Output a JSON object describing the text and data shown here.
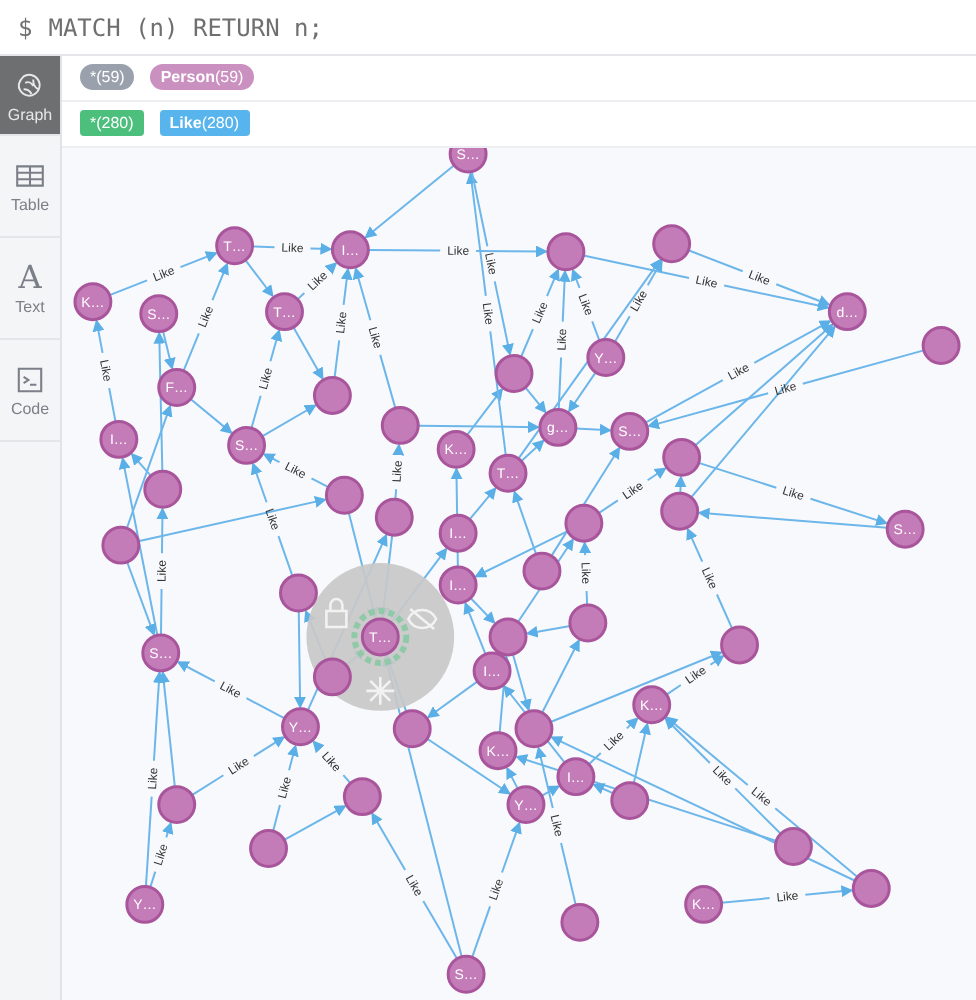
{
  "query": {
    "prompt": "$",
    "text": "MATCH (n) RETURN n;"
  },
  "sidebar": {
    "items": [
      {
        "kind": "graph",
        "label": "Graph",
        "selected": true
      },
      {
        "kind": "table",
        "label": "Table",
        "selected": false
      },
      {
        "kind": "text",
        "glyph": "A",
        "label": "Text",
        "selected": false
      },
      {
        "kind": "code",
        "label": "Code",
        "selected": false
      }
    ]
  },
  "node_labels": [
    {
      "kind": "all",
      "text": "*(59)",
      "color": "#9aa1ac"
    },
    {
      "kind": "label",
      "name": "Person",
      "count": "(59)",
      "color": "#c990c0"
    }
  ],
  "relationship_types": [
    {
      "kind": "all",
      "text": "*(280)",
      "color": "#4cbf7d"
    },
    {
      "kind": "type",
      "name": "Like",
      "count": "(280)",
      "color": "#57b4ec"
    }
  ],
  "graph": {
    "nodes": [
      {
        "kind": "captioned",
        "caption": "S…"
      },
      {
        "kind": "captioned",
        "caption": "T…"
      },
      {
        "kind": "captioned",
        "caption": "I…"
      },
      {
        "kind": "plain"
      },
      {
        "kind": "plain"
      },
      {
        "kind": "captioned",
        "caption": "K…"
      },
      {
        "kind": "captioned",
        "caption": "S…"
      },
      {
        "kind": "captioned",
        "caption": "T…"
      },
      {
        "kind": "captioned",
        "caption": "d…"
      },
      {
        "kind": "plain"
      },
      {
        "kind": "captioned",
        "caption": "Y…"
      },
      {
        "kind": "captioned",
        "caption": "F…"
      },
      {
        "kind": "plain"
      },
      {
        "kind": "plain"
      },
      {
        "kind": "captioned",
        "caption": "I…"
      },
      {
        "kind": "captioned",
        "caption": "S…"
      },
      {
        "kind": "plain"
      },
      {
        "kind": "captioned",
        "caption": "g…"
      },
      {
        "kind": "captioned",
        "caption": "S…"
      },
      {
        "kind": "captioned",
        "caption": "K…"
      },
      {
        "kind": "plain"
      },
      {
        "kind": "plain"
      },
      {
        "kind": "captioned",
        "caption": "T…"
      },
      {
        "kind": "plain"
      },
      {
        "kind": "plain"
      },
      {
        "kind": "captioned",
        "caption": "I…"
      },
      {
        "kind": "plain"
      },
      {
        "kind": "plain"
      },
      {
        "kind": "plain"
      },
      {
        "kind": "captioned",
        "caption": "S…"
      },
      {
        "kind": "plain"
      },
      {
        "kind": "plain"
      },
      {
        "kind": "captioned",
        "caption": "I…"
      },
      {
        "kind": "captioned",
        "caption": "S…"
      },
      {
        "kind": "plain"
      },
      {
        "kind": "captioned",
        "caption": "T…",
        "selected": true
      },
      {
        "kind": "plain"
      },
      {
        "kind": "plain"
      },
      {
        "kind": "captioned",
        "caption": "I…"
      },
      {
        "kind": "plain"
      },
      {
        "kind": "captioned",
        "caption": "Y…"
      },
      {
        "kind": "plain"
      },
      {
        "kind": "captioned",
        "caption": "K…"
      },
      {
        "kind": "plain"
      },
      {
        "kind": "captioned",
        "caption": "I…"
      },
      {
        "kind": "captioned",
        "caption": "K…"
      },
      {
        "kind": "plain"
      },
      {
        "kind": "plain"
      },
      {
        "kind": "captioned",
        "caption": "Y…"
      },
      {
        "kind": "plain"
      },
      {
        "kind": "plain"
      },
      {
        "kind": "captioned",
        "caption": "Y…"
      },
      {
        "kind": "plain"
      },
      {
        "kind": "plain"
      },
      {
        "kind": "captioned",
        "caption": "K…"
      },
      {
        "kind": "plain"
      },
      {
        "kind": "captioned",
        "caption": "S…"
      }
    ],
    "relationships": [
      {
        "label": "Like"
      },
      {
        "label": "Like"
      },
      {
        "label": "Like"
      },
      {
        "label": "Like"
      },
      {
        "label": "Like"
      },
      {
        "label": "Like"
      },
      {
        "label": "Like"
      },
      {
        "label": "Like"
      },
      {
        "label": "Like"
      },
      {
        "label": "Like"
      },
      {
        "label": "Like"
      },
      {
        "label": "Like"
      },
      {
        "label": "Like"
      },
      {
        "label": "Like"
      },
      {
        "label": "Like"
      },
      {
        "label": "Like"
      },
      {
        "label": "Like"
      },
      {
        "label": "Like"
      },
      {
        "label": "Like"
      },
      {
        "label": "Like"
      },
      {
        "label": "Like"
      },
      {
        "label": "Like"
      },
      {
        "label": "Like"
      },
      {
        "label": "Like"
      },
      {
        "label": "Like"
      },
      {
        "label": "Like"
      },
      {
        "label": "Like"
      },
      {
        "label": "Like"
      },
      {
        "label": "Like"
      },
      {
        "label": "Like"
      },
      {
        "label": "Like"
      },
      {
        "label": "Like"
      },
      {
        "label": "Like"
      },
      {
        "label": "Like"
      },
      {
        "label": "Like"
      },
      {
        "label": "Like"
      },
      {
        "label": "Like"
      },
      {
        "label": "Like"
      },
      {
        "label": "Like"
      },
      {
        "label": "Like"
      },
      {
        "label": "Like"
      }
    ]
  }
}
